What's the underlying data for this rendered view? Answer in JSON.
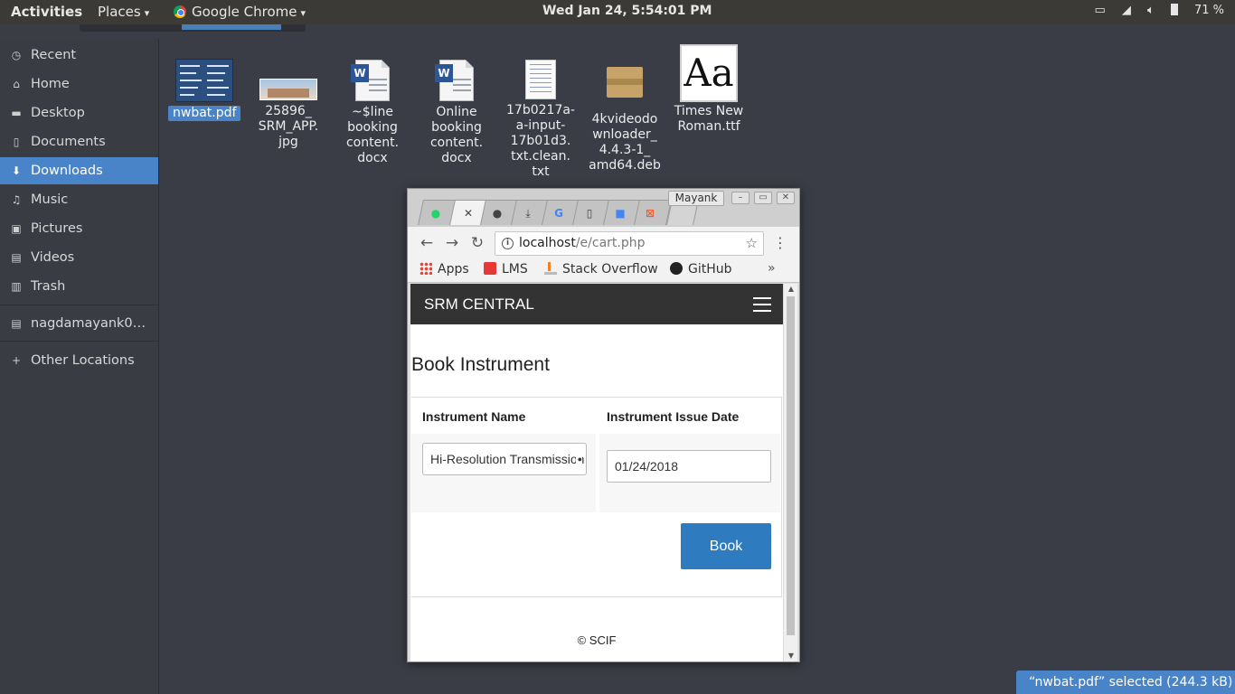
{
  "topbar": {
    "activities": "Activities",
    "places": "Places",
    "app": "Google Chrome",
    "clock": "Wed Jan 24,  5:54:01 PM",
    "battery": "71 %"
  },
  "sidebar": {
    "items": [
      {
        "label": "Recent",
        "icon": "clock-icon"
      },
      {
        "label": "Home",
        "icon": "home-icon"
      },
      {
        "label": "Desktop",
        "icon": "desktop-icon"
      },
      {
        "label": "Documents",
        "icon": "document-icon"
      },
      {
        "label": "Downloads",
        "icon": "download-icon"
      },
      {
        "label": "Music",
        "icon": "music-icon"
      },
      {
        "label": "Pictures",
        "icon": "picture-icon"
      },
      {
        "label": "Videos",
        "icon": "video-icon"
      },
      {
        "label": "Trash",
        "icon": "trash-icon"
      },
      {
        "label": "nagdamayank0…",
        "icon": "drive-icon"
      },
      {
        "label": "Other Locations",
        "icon": "plus-icon"
      }
    ]
  },
  "files": [
    {
      "name": "nwbat.pdf",
      "kind": "pdf",
      "selected": true
    },
    {
      "name": "25896_\nSRM_APP.\njpg",
      "kind": "jpg"
    },
    {
      "name": "~$line\nbooking\ncontent.\ndocx",
      "kind": "docx"
    },
    {
      "name": "Online\nbooking\ncontent.\ndocx",
      "kind": "docx"
    },
    {
      "name": "17b0217a-\na-input-\n17b01d3.\ntxt.clean.\ntxt",
      "kind": "txt"
    },
    {
      "name": "4kvideodo\nwnloader_\n4.4.3-1_\namd64.deb",
      "kind": "deb"
    },
    {
      "name": "Times New\nRoman.ttf",
      "kind": "ttf",
      "glyph": "Aa"
    }
  ],
  "status": "“nwbat.pdf” selected  (244.3 kB)",
  "chrome": {
    "profile": "Mayank",
    "url_host": "localhost",
    "url_path": "/e/cart.php",
    "bookmarks": {
      "apps": "Apps",
      "lms": "LMS",
      "stackoverflow": "Stack Overflow",
      "github": "GitHub",
      "more": "»"
    },
    "colors": {
      "nav_bg": "#333333",
      "book_button": "#2e7bbf",
      "selection": "#4a84c8"
    }
  },
  "page": {
    "brand": "SRM CENTRAL",
    "heading": "Book Instrument",
    "col_instrument": "Instrument Name",
    "col_date": "Instrument Issue Date",
    "instrument_value": "Hi-Resolution Transmission Electron Microscope",
    "date_value": "01/24/2018",
    "book_label": "Book",
    "footer": "© SCIF"
  }
}
